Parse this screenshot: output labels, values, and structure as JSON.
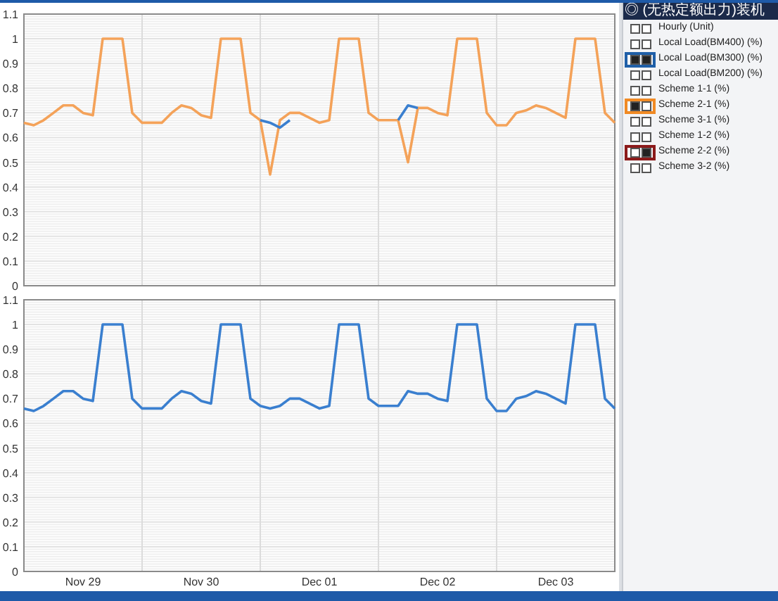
{
  "charts": [
    {
      "chart_data": {
        "type": "line",
        "grid": true,
        "ylim": [
          0,
          1.1
        ],
        "yticks": [
          0,
          0.1,
          0.2,
          0.3,
          0.4,
          0.5,
          0.6,
          0.7,
          0.8,
          0.9,
          1,
          1.1
        ],
        "series": [
          {
            "color": "#3a7fcf",
            "values": [
              null,
              null,
              null,
              null,
              null,
              null,
              null,
              null,
              null,
              null,
              null,
              null,
              null,
              null,
              null,
              null,
              null,
              null,
              null,
              null,
              null,
              null,
              null,
              null,
              0.67,
              0.66,
              0.64,
              0.67,
              null,
              null,
              null,
              null,
              null,
              null,
              null,
              null,
              null,
              null,
              0.67,
              0.73,
              0.72,
              null,
              null,
              null,
              null,
              null,
              null,
              null,
              null,
              null,
              null,
              null,
              null,
              null,
              null,
              null,
              null,
              null,
              null,
              null,
              null
            ]
          },
          {
            "color": "#f4a259",
            "values": [
              0.66,
              0.65,
              0.67,
              0.7,
              0.73,
              0.73,
              0.7,
              0.69,
              1,
              1,
              1,
              0.7,
              0.66,
              0.66,
              0.66,
              0.7,
              0.73,
              0.72,
              0.69,
              0.68,
              1,
              1,
              1,
              0.7,
              0.67,
              0.45,
              0.67,
              0.7,
              0.7,
              0.68,
              0.66,
              0.67,
              1,
              1,
              1,
              0.7,
              0.67,
              0.67,
              0.67,
              0.5,
              0.72,
              0.72,
              0.7,
              0.69,
              1,
              1,
              1,
              0.7,
              0.65,
              0.65,
              0.7,
              0.71,
              0.73,
              0.72,
              0.7,
              0.68,
              1,
              1,
              1,
              0.7,
              0.66
            ]
          }
        ]
      }
    },
    {
      "chart_data": {
        "type": "line",
        "grid": true,
        "categories": [
          null,
          null,
          null,
          null,
          null,
          null,
          "Nov 29",
          null,
          null,
          null,
          null,
          null,
          null,
          null,
          null,
          null,
          null,
          null,
          "Nov 30",
          null,
          null,
          null,
          null,
          null,
          null,
          null,
          null,
          null,
          null,
          null,
          "Dec 01",
          null,
          null,
          null,
          null,
          null,
          null,
          null,
          null,
          null,
          null,
          null,
          "Dec 02",
          null,
          null,
          null,
          null,
          null,
          null,
          null,
          null,
          null,
          null,
          null,
          "Dec 03",
          null,
          null,
          null,
          null,
          null,
          null
        ],
        "ylim": [
          0,
          1.1
        ],
        "yticks": [
          0,
          0.1,
          0.2,
          0.3,
          0.4,
          0.5,
          0.6,
          0.7,
          0.8,
          0.9,
          1,
          1.1
        ],
        "series": [
          {
            "color": "#3a7fcf",
            "values": [
              0.66,
              0.65,
              0.67,
              0.7,
              0.73,
              0.73,
              0.7,
              0.69,
              1,
              1,
              1,
              0.7,
              0.66,
              0.66,
              0.66,
              0.7,
              0.73,
              0.72,
              0.69,
              0.68,
              1,
              1,
              1,
              0.7,
              0.67,
              0.66,
              0.67,
              0.7,
              0.7,
              0.68,
              0.66,
              0.67,
              1,
              1,
              1,
              0.7,
              0.67,
              0.67,
              0.67,
              0.73,
              0.72,
              0.72,
              0.7,
              0.69,
              1,
              1,
              1,
              0.7,
              0.65,
              0.65,
              0.7,
              0.71,
              0.73,
              0.72,
              0.7,
              0.68,
              1,
              1,
              1,
              0.7,
              0.66
            ]
          }
        ]
      }
    }
  ],
  "legend": {
    "title": "◎ (无热定额出力)装机",
    "items": [
      {
        "label": "Hourly (Unit)",
        "checked_1": false,
        "checked_2": false
      },
      {
        "label": "Local Load(BM400) (%)",
        "checked_1": false,
        "checked_2": false
      },
      {
        "label": "Local Load(BM300) (%)",
        "checked_1": true,
        "checked_2": true,
        "color": "#1f5fa8"
      },
      {
        "label": "Local Load(BM200) (%)",
        "checked_1": false,
        "checked_2": false
      },
      {
        "label": "Scheme 1-1 (%)",
        "checked_1": false,
        "checked_2": false
      },
      {
        "label": "Scheme 2-1 (%)",
        "checked_1": true,
        "checked_2": false,
        "color": "#f08a24"
      },
      {
        "label": "Scheme 3-1 (%)",
        "checked_1": false,
        "checked_2": false
      },
      {
        "label": "Scheme 1-2 (%)",
        "checked_1": false,
        "checked_2": false
      },
      {
        "label": "Scheme 2-2 (%)",
        "checked_1": false,
        "checked_2": true,
        "color": "#8b1a1a"
      },
      {
        "label": "Scheme 3-2 (%)",
        "checked_1": false,
        "checked_2": false
      }
    ]
  }
}
